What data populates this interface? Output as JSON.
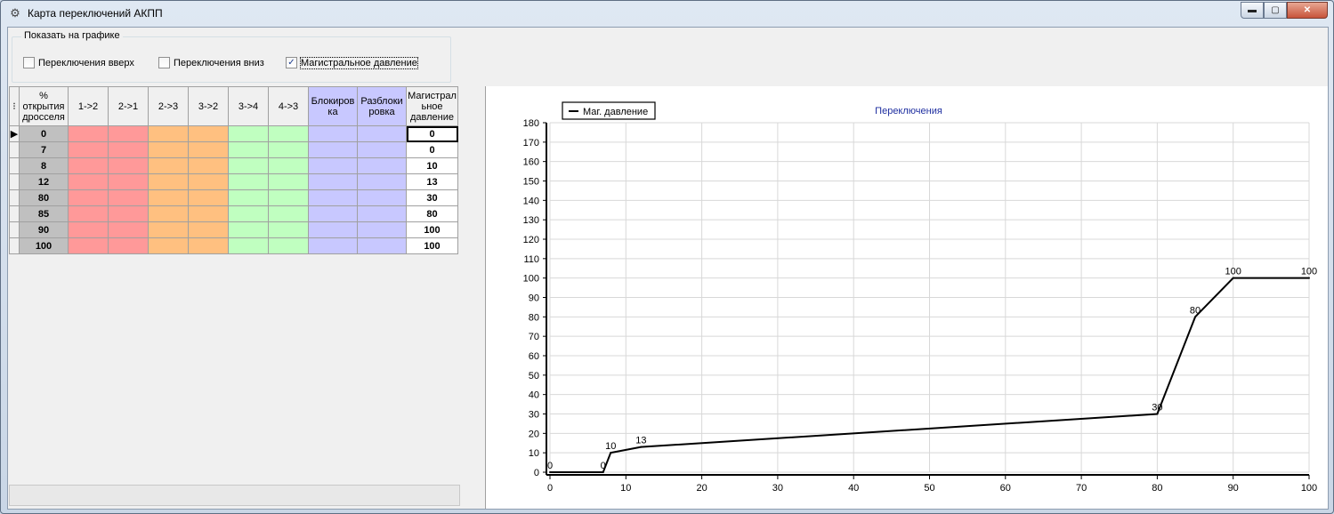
{
  "window": {
    "title": "Карта переключений АКПП",
    "min": "▬",
    "max": "▢",
    "close": "✕"
  },
  "group": {
    "label": "Показать на графике",
    "checkboxes": [
      {
        "label": "Переключения вверх",
        "checked": false
      },
      {
        "label": "Переключения вниз",
        "checked": false
      },
      {
        "label": "Магистральное давление",
        "checked": true
      }
    ]
  },
  "table": {
    "row_selector_icon": "⁝",
    "headers": [
      "% открытия дросселя",
      "1->2",
      "2->1",
      "2->3",
      "3->2",
      "3->4",
      "4->3",
      "Блокиров ка",
      "Разблоки ровка",
      "Магистрал ьное давление"
    ],
    "rows": [
      {
        "throttle": "0",
        "pressure": "0"
      },
      {
        "throttle": "7",
        "pressure": "0"
      },
      {
        "throttle": "8",
        "pressure": "10"
      },
      {
        "throttle": "12",
        "pressure": "13"
      },
      {
        "throttle": "80",
        "pressure": "30"
      },
      {
        "throttle": "85",
        "pressure": "80"
      },
      {
        "throttle": "90",
        "pressure": "100"
      },
      {
        "throttle": "100",
        "pressure": "100"
      }
    ],
    "current_row_marker": "▶"
  },
  "colors": {
    "red": "#ff9999",
    "orange": "#ffc080",
    "green": "#c0ffc0",
    "blue": "#c8c8ff",
    "throttle": "#c0c0c0",
    "title": "#1f2fa0"
  },
  "chart_data": {
    "type": "line",
    "title": "Переключения",
    "legend": "top-left",
    "series": [
      {
        "name": "Маг. давление",
        "x": [
          0,
          7,
          8,
          12,
          80,
          85,
          90,
          100
        ],
        "values": [
          0,
          0,
          10,
          13,
          30,
          80,
          100,
          100
        ]
      }
    ],
    "point_labels": [
      "0",
      "0",
      "10",
      "13",
      "30",
      "80",
      "100",
      "100"
    ],
    "xlim": [
      0,
      100
    ],
    "xticks": [
      0,
      10,
      20,
      30,
      40,
      50,
      60,
      70,
      80,
      90,
      100
    ],
    "ylim": [
      0,
      180
    ],
    "yticks": [
      0,
      10,
      20,
      30,
      40,
      50,
      60,
      70,
      80,
      90,
      100,
      110,
      120,
      130,
      140,
      150,
      160,
      170,
      180
    ],
    "grid": true
  }
}
